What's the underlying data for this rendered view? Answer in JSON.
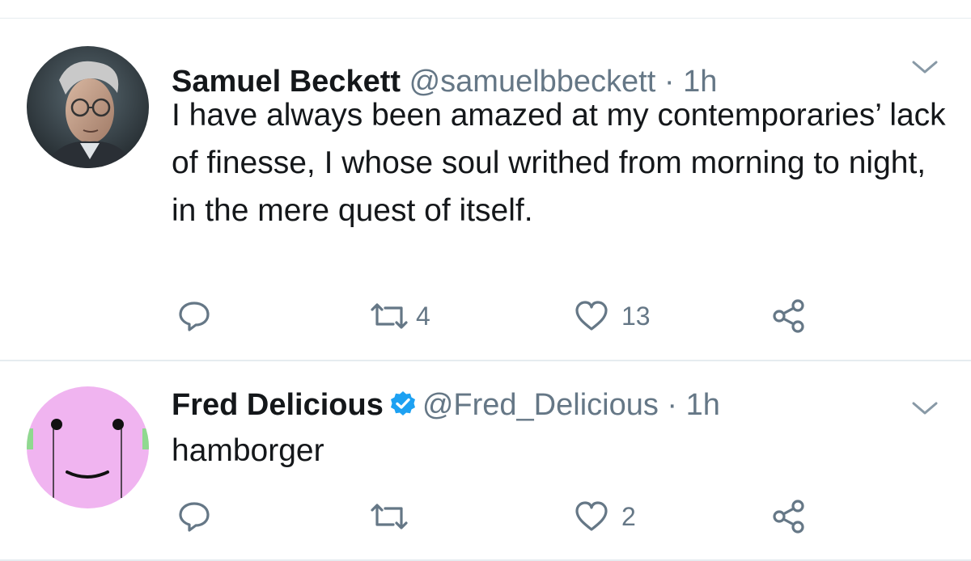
{
  "tweets": [
    {
      "name": "Samuel Beckett",
      "handle": "@samuelbbeckett",
      "separator": "·",
      "time": "1h",
      "verified": false,
      "text": "I have always been amazed at my contemporaries’ lack of finesse, I whose soul writhed from morning to night, in the mere quest of itself.",
      "reply_count": "",
      "retweet_count": "4",
      "like_count": "13",
      "avatar": "photo-avatar",
      "menu_icon": "chevron-down-icon"
    },
    {
      "name": "Fred Delicious",
      "handle": "@Fred_Delicious",
      "separator": "·",
      "time": "1h",
      "verified": true,
      "text": "hamborger",
      "reply_count": "",
      "retweet_count": "",
      "like_count": "2",
      "avatar": "smiley-face-avatar",
      "menu_icon": "chevron-down-icon"
    }
  ],
  "colors": {
    "text": "#14171a",
    "secondary": "#657786",
    "verified": "#1da1f2",
    "divider": "#e6ecf0",
    "avatar2_bg": "#f0b4f0"
  }
}
